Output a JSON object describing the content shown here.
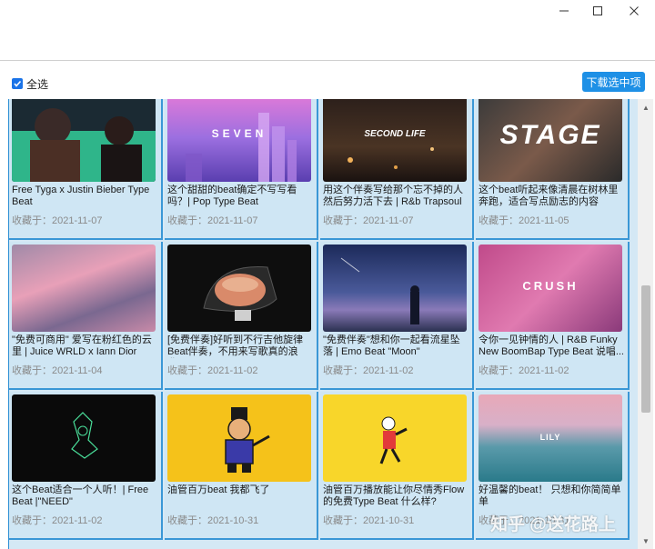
{
  "window": {
    "minimize_icon": "minimize-icon",
    "maximize_icon": "maximize-icon",
    "close_icon": "close-icon"
  },
  "toolbar": {
    "select_all_label": "全选",
    "select_all_checked": true,
    "download_button_label": "下载选中项"
  },
  "colors": {
    "accent": "#1e90e6",
    "card_bg": "#cfe6f4",
    "card_border": "#3a97d6"
  },
  "cards": [
    {
      "title": "Free Tyga x Justin Bieber Type Beat",
      "date": "收藏于：2021-11-07",
      "thumb_text": ""
    },
    {
      "title": "这个甜甜的beat确定不写写看吗？| Pop Type Beat",
      "date": "收藏于：2021-11-07",
      "thumb_text": "SEVEN"
    },
    {
      "title": "用这个伴奏写给那个忘不掉的人然后努力活下去 | R&b Trapsoul T...",
      "date": "收藏于：2021-11-07",
      "thumb_text": "SECOND LIFE"
    },
    {
      "title": "这个beat听起来像清晨在树林里奔跑，适合写点励志的内容",
      "date": "收藏于：2021-11-05",
      "thumb_text": "STAGE"
    },
    {
      "title": "\"免费可商用\" 爱写在粉红色的云里 | Juice WRLD x Iann Dior Type...",
      "date": "收藏于：2021-11-04",
      "thumb_text": ""
    },
    {
      "title": "[免费伴奏]好听到不行吉他旋律Beat伴奏，不用来写歌真的浪费...",
      "date": "收藏于：2021-11-02",
      "thumb_text": ""
    },
    {
      "title": "\"免费伴奏\"想和你一起看流星坠落 | Emo Beat \"Moon\"",
      "date": "收藏于：2021-11-02",
      "thumb_text": ""
    },
    {
      "title": "令你一见钟情的人 | R&B Funky New BoomBap Type Beat 说唱...",
      "date": "收藏于：2021-11-02",
      "thumb_text": "CRUSH"
    },
    {
      "title": "这个Beat适合一个人听！| Free Beat |\"NEED\"",
      "date": "收藏于：2021-11-02",
      "thumb_text": ""
    },
    {
      "title": "油管百万beat 我都飞了",
      "date": "收藏于：2021-10-31",
      "thumb_text": ""
    },
    {
      "title": "油管百万播放能让你尽情秀Flow的免费Type Beat 什么样?",
      "date": "收藏于：2021-10-31",
      "thumb_text": ""
    },
    {
      "title": "好温馨的beat！ 只想和你简简单单",
      "date": "收藏于：2021-10-31",
      "thumb_text": "LILY"
    }
  ],
  "watermark": "知乎 @送花路上"
}
